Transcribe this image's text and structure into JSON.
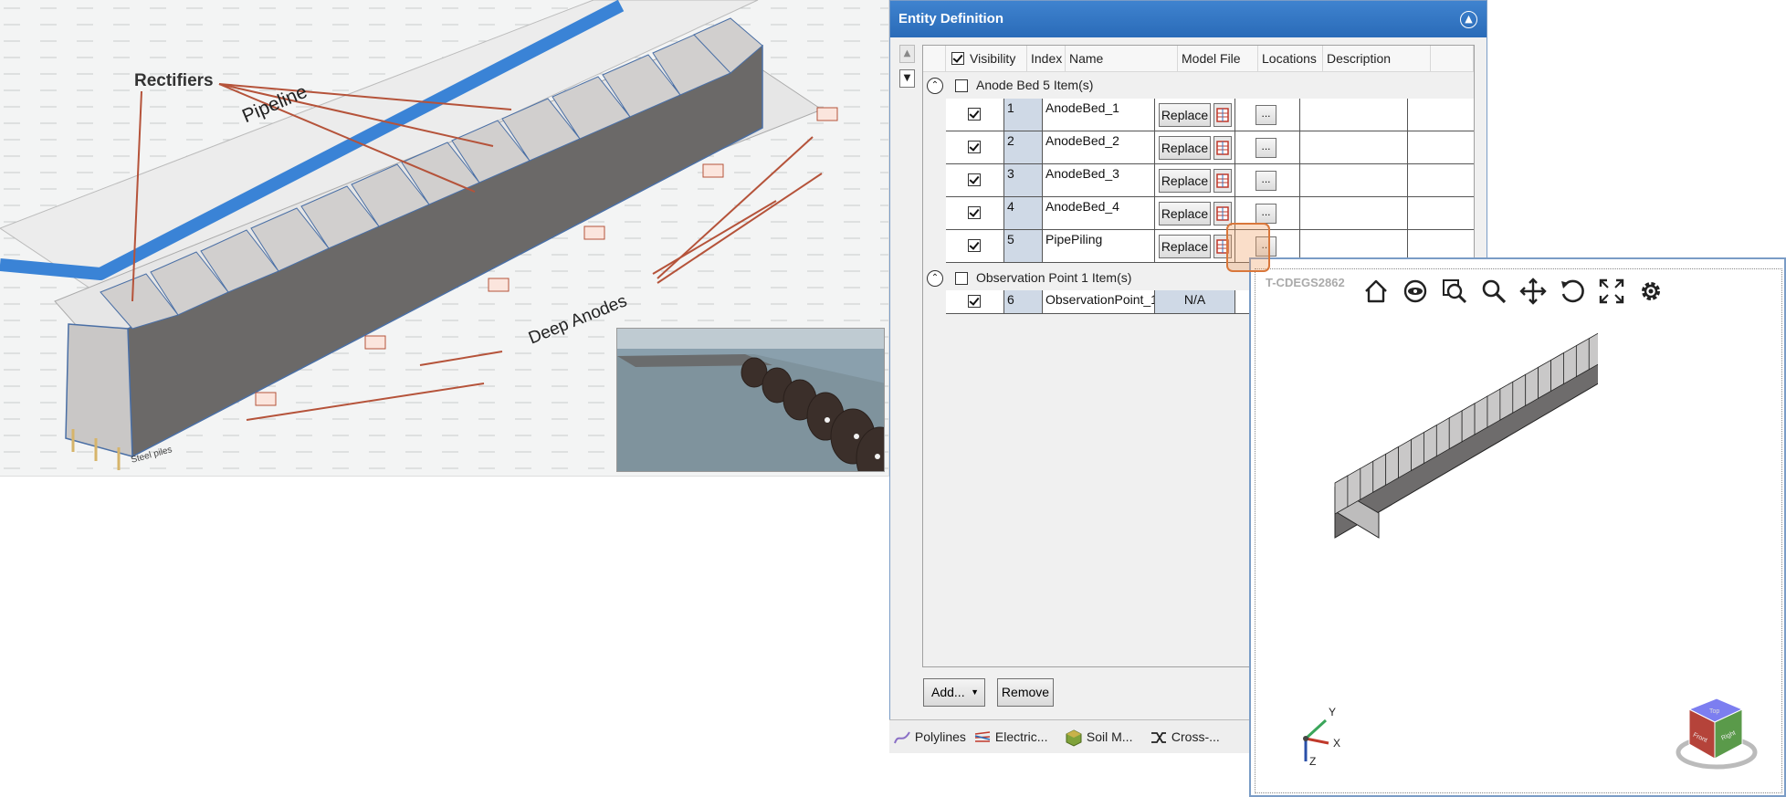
{
  "illustration": {
    "label_rectifiers": "Rectifiers",
    "label_pipeline": "Pipeline",
    "label_deep_anodes": "Deep Anodes",
    "label_piles": "Steel piles"
  },
  "panel": {
    "title": "Entity Definition",
    "columns": {
      "visibility": "Visibility",
      "index": "Index",
      "name": "Name",
      "model_file": "Model File",
      "locations": "Locations",
      "description": "Description"
    },
    "groups": [
      {
        "label": "Anode Bed 5 Item(s)",
        "rows": [
          {
            "index": "1",
            "name": "AnodeBed_1",
            "model": "Replace",
            "locations": "..."
          },
          {
            "index": "2",
            "name": "AnodeBed_2",
            "model": "Replace",
            "locations": "..."
          },
          {
            "index": "3",
            "name": "AnodeBed_3",
            "model": "Replace",
            "locations": "..."
          },
          {
            "index": "4",
            "name": "AnodeBed_4",
            "model": "Replace",
            "locations": "..."
          },
          {
            "index": "5",
            "name": "PipePiling",
            "model": "Replace",
            "locations": "..."
          }
        ]
      },
      {
        "label": "Observation Point 1 Item(s)",
        "rows": [
          {
            "index": "6",
            "name": "ObservationPoint_1",
            "model": "N/A"
          }
        ]
      }
    ],
    "add_label": "Add...",
    "remove_label": "Remove"
  },
  "tabs": [
    "Polylines",
    "Electric...",
    "Soil M...",
    "Cross-..."
  ],
  "viewer": {
    "title": "T-CDEGS2862",
    "tools": [
      "home-icon",
      "orbit-icon",
      "zoom-window-icon",
      "zoom-icon",
      "pan-icon",
      "rotate-icon",
      "fit-screen-icon",
      "settings-icon"
    ],
    "axis_labels": {
      "x": "X",
      "y": "Y",
      "z": "Z"
    },
    "cube_labels": {
      "top": "Top",
      "front": "Front",
      "right": "Right"
    }
  },
  "colors": {
    "title_bar": "#2a6bb8",
    "pipeline": "#3a83d6",
    "highlight": "#d9773b",
    "index_cell": "#cfd9e6"
  }
}
